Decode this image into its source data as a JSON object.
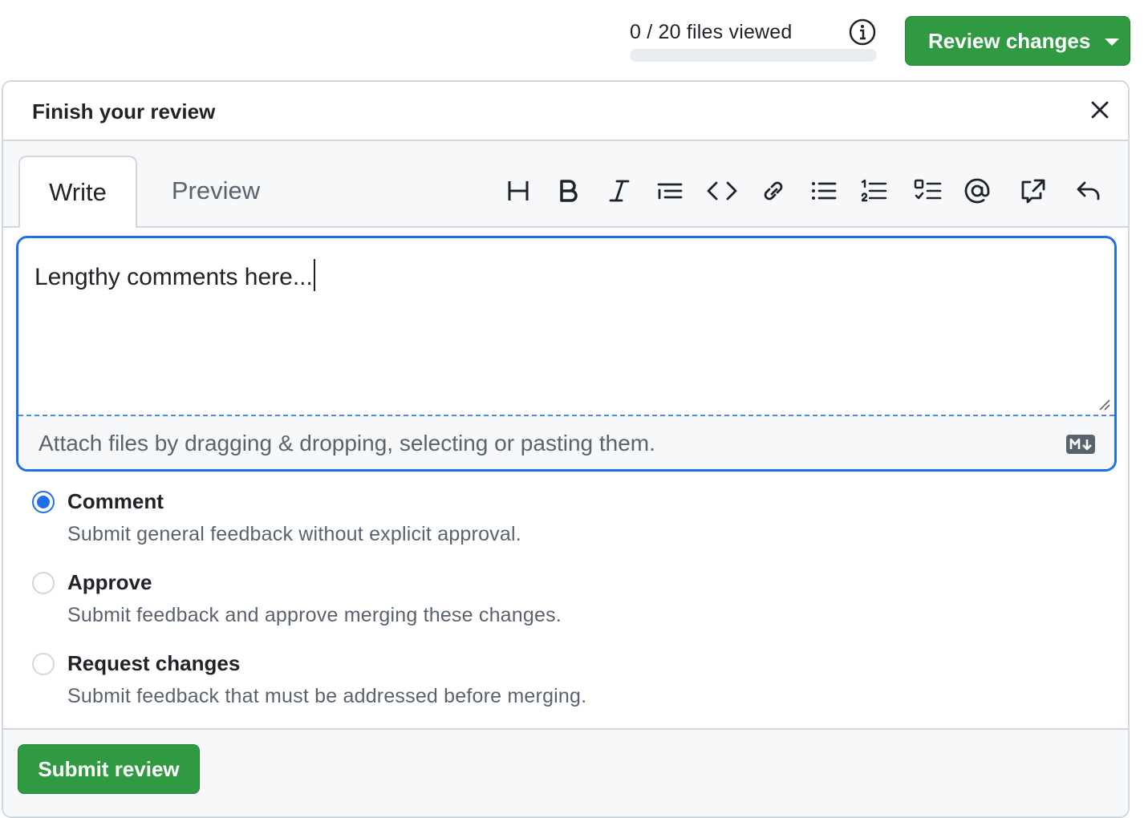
{
  "header": {
    "files_viewed_text": "0 / 20 files viewed",
    "files_viewed_progress": 0,
    "info_icon": "info-icon",
    "review_button_label": "Review changes"
  },
  "panel": {
    "title": "Finish your review",
    "close_icon": "close-icon",
    "tabs": [
      {
        "label": "Write",
        "active": true
      },
      {
        "label": "Preview",
        "active": false
      }
    ],
    "toolbar_icons": [
      "heading-icon",
      "bold-icon",
      "italic-icon",
      "quote-icon",
      "code-icon",
      "link-icon",
      "bulleted-list-icon",
      "numbered-list-icon",
      "task-list-icon",
      "mention-icon",
      "cross-reference-icon",
      "undo-icon"
    ],
    "comment_text": "Lengthy comments here...",
    "attach_text": "Attach files by dragging & dropping, selecting or pasting them.",
    "markdown_icon": "markdown-icon"
  },
  "options": [
    {
      "label": "Comment",
      "description": "Submit general feedback without explicit approval.",
      "checked": true
    },
    {
      "label": "Approve",
      "description": "Submit feedback and approve merging these changes.",
      "checked": false
    },
    {
      "label": "Request changes",
      "description": "Submit feedback that must be addressed before merging.",
      "checked": false
    }
  ],
  "footer": {
    "submit_label": "Submit review"
  },
  "colors": {
    "primary_button": "#2f9a42",
    "focus_blue": "#1f6feb",
    "border": "#d0d7de",
    "muted_text": "#59636e"
  }
}
